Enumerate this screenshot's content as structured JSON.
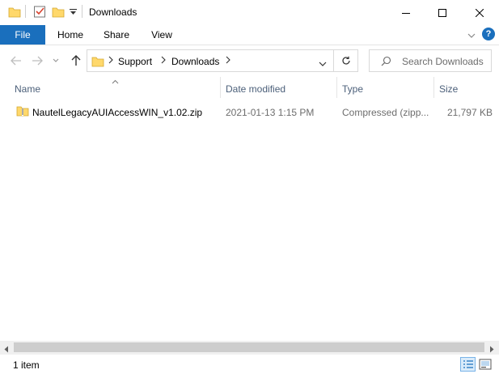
{
  "window": {
    "title": "Downloads"
  },
  "ribbon": {
    "tabs": [
      {
        "label": "File",
        "active": true
      },
      {
        "label": "Home"
      },
      {
        "label": "Share"
      },
      {
        "label": "View"
      }
    ],
    "help_label": "?"
  },
  "address": {
    "breadcrumbs": [
      "Support",
      "Downloads"
    ]
  },
  "search": {
    "placeholder": "Search Downloads"
  },
  "columns": {
    "name": "Name",
    "date": "Date modified",
    "type": "Type",
    "size": "Size"
  },
  "files": [
    {
      "name": "NautelLegacyAUIAccessWIN_v1.02.zip",
      "date": "2021-01-13 1:15 PM",
      "type": "Compressed (zipp...",
      "size": "21,797 KB",
      "icon": "zip-folder-icon"
    }
  ],
  "status": {
    "item_count": "1 item"
  },
  "colors": {
    "accent": "#1a6fbd",
    "folder": "#ffd86b",
    "header_text": "#4c607a"
  }
}
